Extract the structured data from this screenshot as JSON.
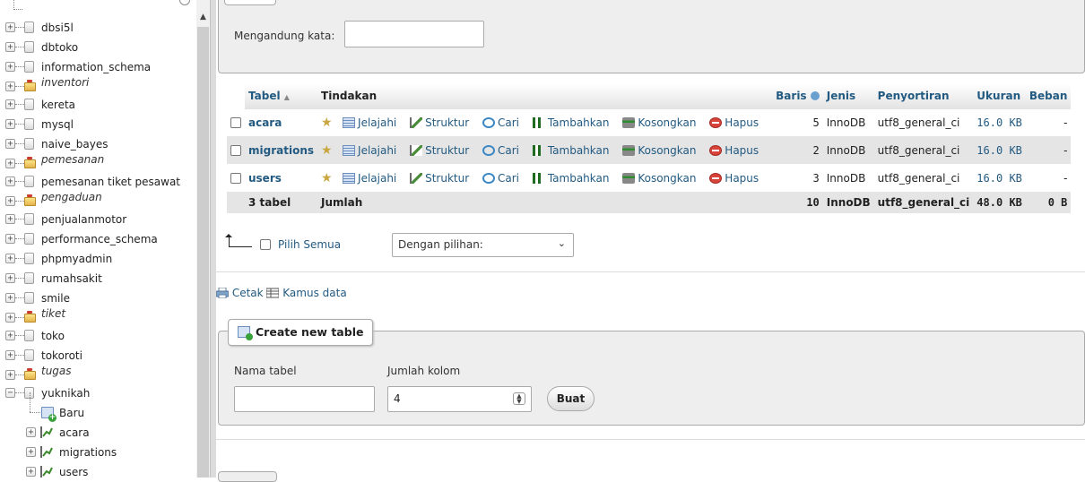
{
  "navigation": {
    "databases": [
      {
        "name": "dbsi5l",
        "style": "normal"
      },
      {
        "name": "dbtoko",
        "style": "normal"
      },
      {
        "name": "information_schema",
        "style": "normal"
      },
      {
        "name": "inventori",
        "style": "group"
      },
      {
        "name": "kereta",
        "style": "normal"
      },
      {
        "name": "mysql",
        "style": "normal"
      },
      {
        "name": "naive_bayes",
        "style": "normal"
      },
      {
        "name": "pemesanan",
        "style": "group"
      },
      {
        "name": "pemesanan tiket pesawat",
        "style": "normal"
      },
      {
        "name": "pengaduan",
        "style": "group"
      },
      {
        "name": "penjualanmotor",
        "style": "normal"
      },
      {
        "name": "performance_schema",
        "style": "normal"
      },
      {
        "name": "phpmyadmin",
        "style": "normal"
      },
      {
        "name": "rumahsakit",
        "style": "normal"
      },
      {
        "name": "smile",
        "style": "normal"
      },
      {
        "name": "tiket",
        "style": "group"
      },
      {
        "name": "toko",
        "style": "normal"
      },
      {
        "name": "tokoroti",
        "style": "normal"
      },
      {
        "name": "tugas",
        "style": "group"
      },
      {
        "name": "yuknikah",
        "style": "expanded"
      }
    ],
    "children": {
      "new_label": "Baru",
      "tables": [
        "acara",
        "migrations",
        "users"
      ]
    }
  },
  "filter": {
    "label": "Mengandung kata:",
    "value": ""
  },
  "table": {
    "headers": {
      "table": "Tabel",
      "sort_arrow": "▲",
      "action": "Tindakan",
      "rows": "Baris",
      "type": "Jenis",
      "collation": "Penyortiran",
      "size": "Ukuran",
      "overhead": "Beban"
    },
    "actions": {
      "browse": "Jelajahi",
      "structure": "Struktur",
      "search": "Cari",
      "insert": "Tambahkan",
      "empty": "Kosongkan",
      "drop": "Hapus"
    },
    "rows": [
      {
        "name": "acara",
        "rows": "5",
        "type": "InnoDB",
        "collation": "utf8_general_ci",
        "size": "16.0",
        "unit": "KB",
        "overhead": "-"
      },
      {
        "name": "migrations",
        "rows": "2",
        "type": "InnoDB",
        "collation": "utf8_general_ci",
        "size": "16.0",
        "unit": "KB",
        "overhead": "-"
      },
      {
        "name": "users",
        "rows": "3",
        "type": "InnoDB",
        "collation": "utf8_general_ci",
        "size": "16.0",
        "unit": "KB",
        "overhead": "-"
      }
    ],
    "footer": {
      "count": "3 tabel",
      "label": "Jumlah",
      "rows": "10",
      "type": "InnoDB",
      "collation": "utf8_general_ci",
      "size": "48.0",
      "unit": "KB",
      "overhead": "0 B"
    }
  },
  "bulk": {
    "check_all": "Pilih Semua",
    "with_selected": "Dengan pilihan:"
  },
  "links": {
    "print": "Cetak",
    "dictionary": "Kamus data"
  },
  "create": {
    "legend": "Create new table",
    "name_label": "Nama tabel",
    "cols_label": "Jumlah kolom",
    "cols_value": "4",
    "button": "Buat"
  },
  "colors": {
    "link": "#235a81",
    "row_even": "#e5e5e5",
    "panel": "#eeeeee"
  }
}
